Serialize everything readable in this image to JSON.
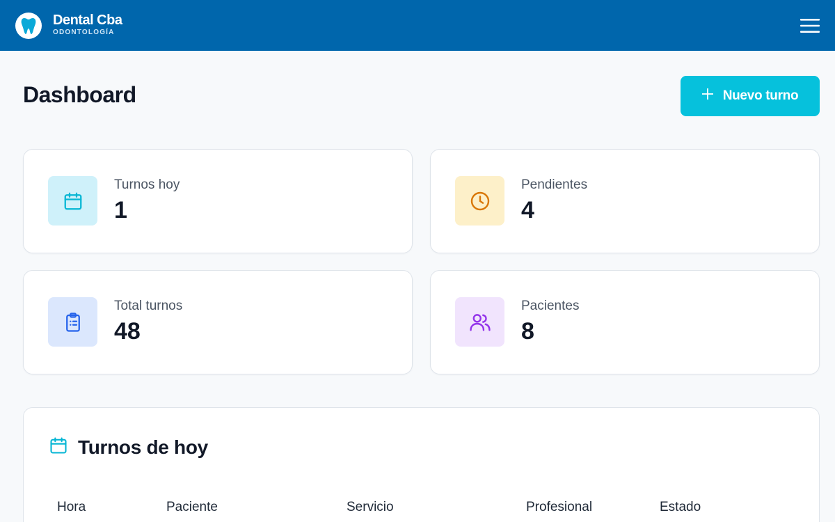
{
  "brand": {
    "name": "Dental Cba",
    "subtitle": "ODONTOLOGÍA",
    "logo_icon": "tooth-icon",
    "menu_icon": "hamburger-menu-icon"
  },
  "page": {
    "title": "Dashboard",
    "new_button_label": "Nuevo turno",
    "new_button_icon": "plus-icon"
  },
  "stats": [
    {
      "label": "Turnos hoy",
      "value": "1",
      "icon": "calendar-icon",
      "color": "#06b6d4",
      "bg": "#cff1fa"
    },
    {
      "label": "Pendientes",
      "value": "4",
      "icon": "clock-icon",
      "color": "#d97706",
      "bg": "#fdf0c9"
    },
    {
      "label": "Total turnos",
      "value": "48",
      "icon": "clipboard-list-icon",
      "color": "#2563eb",
      "bg": "#dbe7fd"
    },
    {
      "label": "Pacientes",
      "value": "8",
      "icon": "users-icon",
      "color": "#9333ea",
      "bg": "#f1e4fd"
    }
  ],
  "today": {
    "title": "Turnos de hoy",
    "icon": "calendar-icon",
    "columns": [
      "Hora",
      "Paciente",
      "Servicio",
      "Profesional",
      "Estado"
    ]
  },
  "colors": {
    "header": "#0066ac",
    "accent": "#06c1dc",
    "background": "#f7f9fb"
  }
}
